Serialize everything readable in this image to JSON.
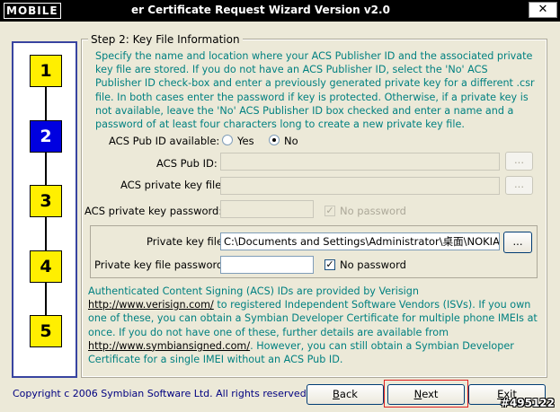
{
  "window": {
    "logo_text": "MOBILE",
    "title": "er Certificate Request Wizard Version v2.0",
    "close_glyph": "✕"
  },
  "steps": [
    "1",
    "2",
    "3",
    "4",
    "5"
  ],
  "active_step": "2",
  "group_title": "Step 2: Key File Information",
  "description": "Specify the name and location where your ACS Publisher ID and the associated private key file are stored. If you do not have an ACS Publisher ID, select the 'No' ACS Publisher ID check-box and enter a previously generated private key for a different .csr file. In both cases enter the password if key is protected. Otherwise, if a private key is not available, leave the 'No' ACS Publisher ID box checked and enter a name and a password of at least four characters long to create a new private key file.",
  "acs_available": {
    "label": "ACS Pub ID available:",
    "yes": "Yes",
    "no": "No",
    "selected": "No"
  },
  "acs_pub_id": {
    "label": "ACS Pub ID:",
    "value": "",
    "browse": "..."
  },
  "acs_private_key_file": {
    "label": "ACS private key file:",
    "value": "",
    "browse": "..."
  },
  "acs_private_key_password": {
    "label": "ACS private key password:",
    "value": "",
    "no_password_label": "No password",
    "no_password_checked": true
  },
  "private_key_file": {
    "label": "Private key file:",
    "value": "C:\\Documents and Settings\\Administrator\\桌面\\NOKIA E",
    "browse": "..."
  },
  "private_key_file_password": {
    "label": "Private key file password:",
    "value": "",
    "no_password_label": "No password",
    "no_password_checked": true
  },
  "info": {
    "p1": "Authenticated Content Signing (ACS) IDs are provided by Verisign ",
    "link1": "http://www.verisign.com/",
    "p2": " to registered Independent Software Vendors (ISVs). If you own one of these, you can obtain a Symbian Developer Certificate for multiple phone IMEIs at once. If you do not have one of these, further details are available from ",
    "link2": "http://www.symbiansigned.com/",
    "p3": ". However, you can still obtain a Symbian Developer Certificate for a single IMEI without an ACS Pub ID."
  },
  "copyright": "Copyright c 2006 Symbian Software Ltd. All rights reserved.",
  "buttons": {
    "back": "Back",
    "next": "Next",
    "exit": "Exit"
  },
  "watermark": "#495122",
  "colors": {
    "active_step": "#0000e0",
    "inactive_step": "#ffef00",
    "description_text": "#008080",
    "copyright_text": "#000080"
  }
}
